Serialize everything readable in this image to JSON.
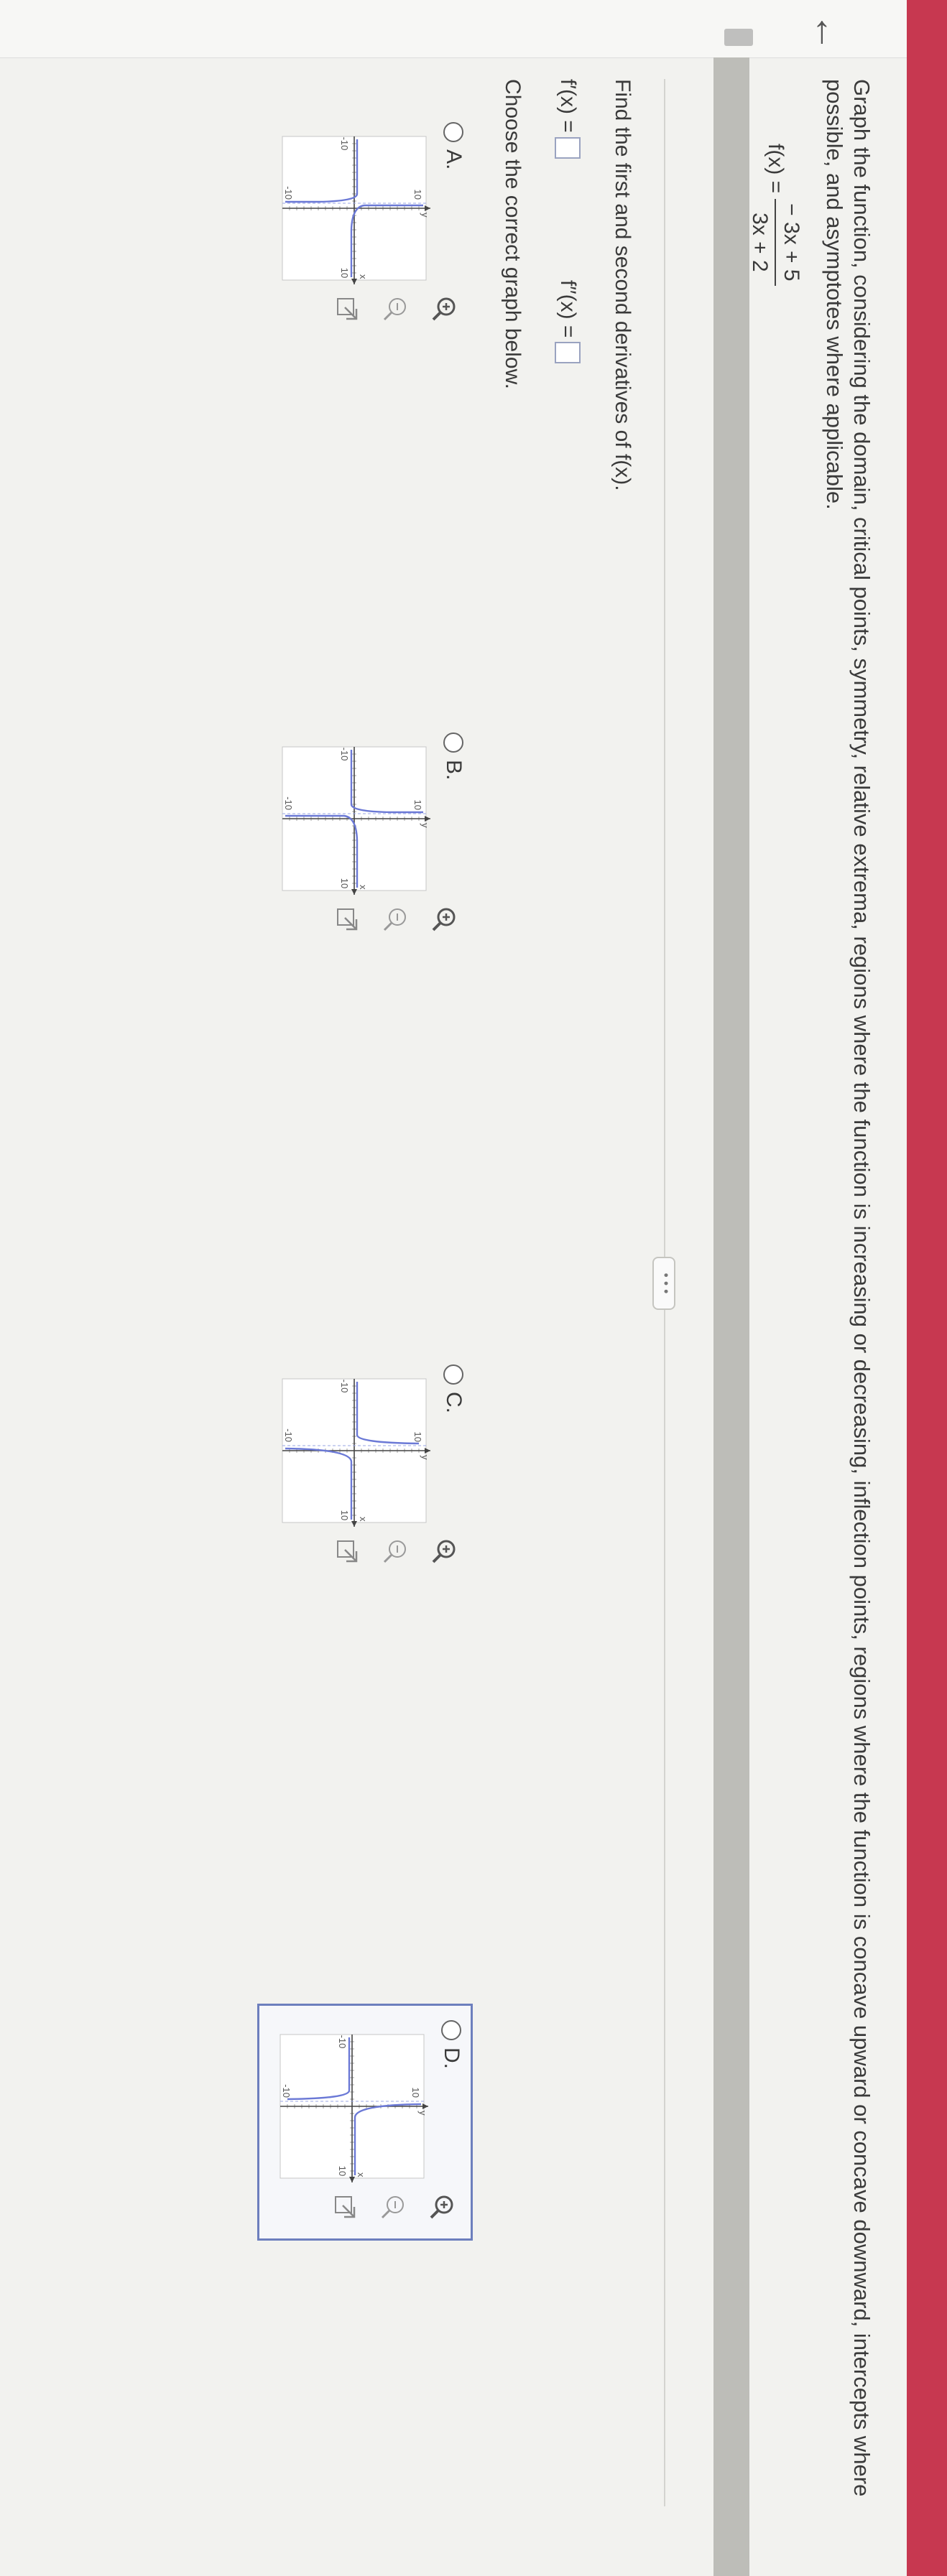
{
  "question": "Graph the function, considering the domain, critical points, symmetry, relative extrema, regions where the function is increasing or decreasing, inflection points, regions where the function is concave upward or concave downward, intercepts where possible, and asymptotes where applicable.",
  "function": {
    "lhs": "f(x) =",
    "numerator": "− 3x + 5",
    "denominator": "3x + 2"
  },
  "more_button": "• • •",
  "derivatives": {
    "instruction": "Find the first and second derivatives of f(x).",
    "first_label": "f′(x) =",
    "second_label": "f′′(x) ="
  },
  "graph_prompt": "Choose the correct graph below.",
  "options": [
    {
      "letter": "A.",
      "x_axis": "x",
      "y_axis": "y",
      "tick_pos": "10",
      "tick_neg": "-10"
    },
    {
      "letter": "B.",
      "x_axis": "x",
      "y_axis": "y",
      "tick_pos": "10",
      "tick_neg": "-10"
    },
    {
      "letter": "C.",
      "x_axis": "x",
      "y_axis": "y",
      "tick_pos": "10",
      "tick_neg": "-10"
    },
    {
      "letter": "D.",
      "x_axis": "x",
      "y_axis": "y",
      "tick_pos": "10",
      "tick_neg": "-10"
    }
  ],
  "tool_icons": [
    "zoom-in-icon",
    "zoom-out-icon",
    "popout-icon"
  ],
  "colors": {
    "topbar": "#c73850",
    "curve": "#6b79d6",
    "selected_border": "#6d7fbd"
  }
}
